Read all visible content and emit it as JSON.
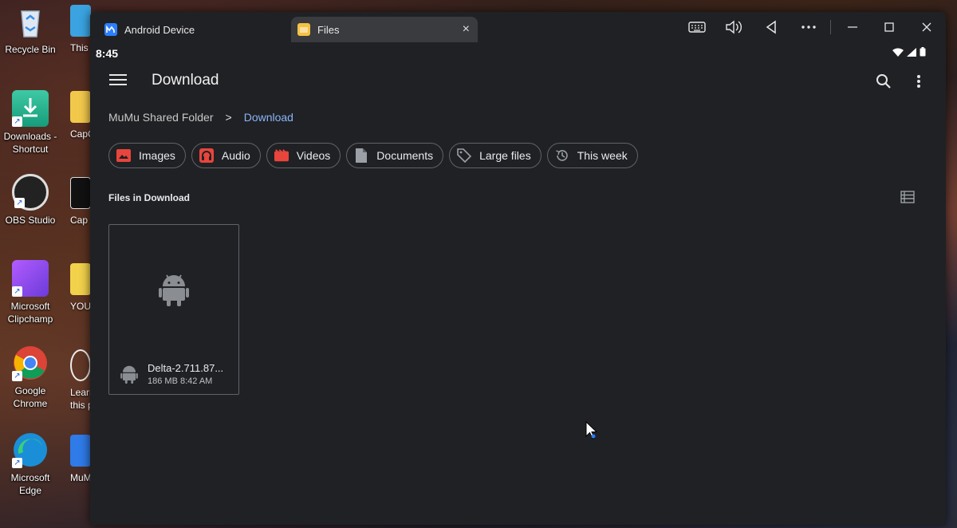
{
  "desktop": {
    "icons": [
      {
        "label": "Recycle Bin"
      },
      {
        "label": "Downloads - Shortcut"
      },
      {
        "label": "OBS Studio"
      },
      {
        "label": "Microsoft Clipchamp"
      },
      {
        "label": "Google Chrome"
      },
      {
        "label": "Microsoft Edge"
      }
    ],
    "partial_icons": [
      {
        "label": "This"
      },
      {
        "label": "CapC"
      },
      {
        "label": "Cap"
      },
      {
        "label": "YOU"
      },
      {
        "label": "Learn this p"
      },
      {
        "label": "MuMu"
      }
    ]
  },
  "window": {
    "tabs": [
      {
        "label": "Android Device"
      },
      {
        "label": "Files"
      }
    ],
    "tab_close": "×"
  },
  "status": {
    "time": "8:45"
  },
  "app": {
    "title": "Download",
    "breadcrumb": {
      "root": "MuMu Shared Folder",
      "separator": ">",
      "current": "Download"
    },
    "chips": [
      {
        "label": "Images",
        "icon": "image-icon",
        "color": "#e8453c"
      },
      {
        "label": "Audio",
        "icon": "headphones-icon",
        "color": "#e8453c"
      },
      {
        "label": "Videos",
        "icon": "movie-icon",
        "color": "#e8453c"
      },
      {
        "label": "Documents",
        "icon": "document-icon",
        "color": "#9aa0a6"
      },
      {
        "label": "Large files",
        "icon": "tag-icon",
        "color": "#9aa0a6"
      },
      {
        "label": "This week",
        "icon": "history-icon",
        "color": "#9aa0a6"
      }
    ],
    "section_label": "Files in Download",
    "files": [
      {
        "name": "Delta-2.711.87...",
        "info": "186 MB 8:42 AM",
        "icon": "android-icon"
      }
    ]
  },
  "colors": {
    "accent": "#8ab4f8",
    "background": "#202124",
    "chip_border": "#5f6368"
  }
}
